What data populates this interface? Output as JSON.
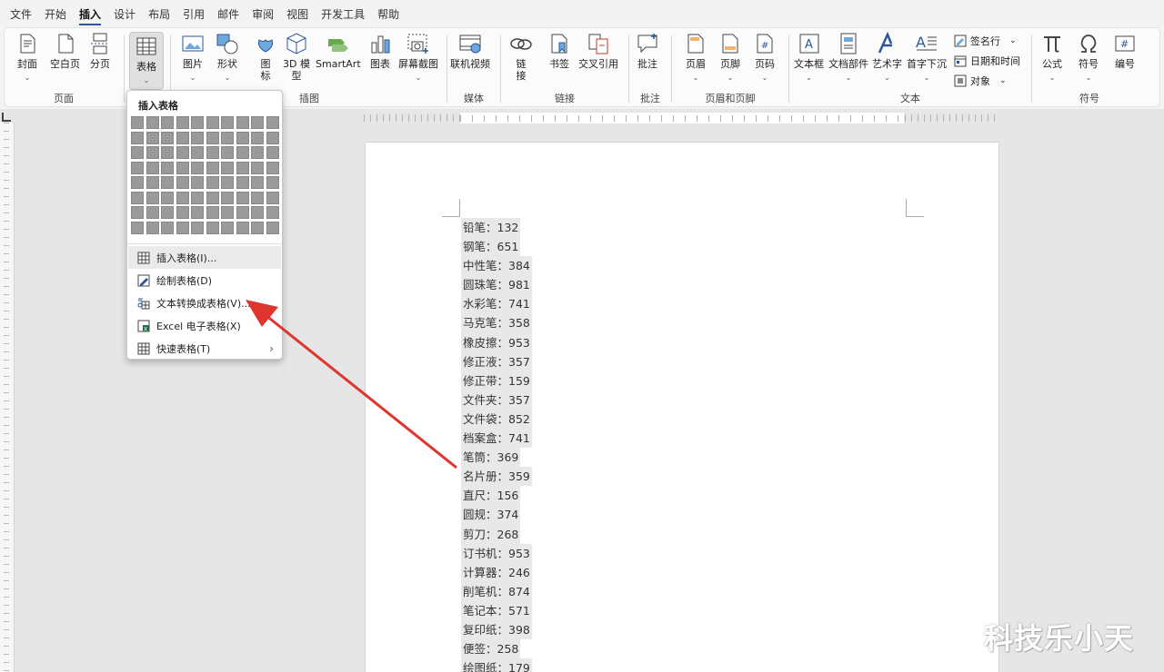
{
  "tabs": [
    "文件",
    "开始",
    "插入",
    "设计",
    "布局",
    "引用",
    "邮件",
    "审阅",
    "视图",
    "开发工具",
    "帮助"
  ],
  "active_tab": "插入",
  "ribbon": {
    "groups": {
      "page": "页面",
      "table": "表格",
      "illustrations": "插图",
      "media": "媒体",
      "links": "链接",
      "comments": "批注",
      "header_footer": "页眉和页脚",
      "text": "文本",
      "symbols": "符号"
    },
    "buttons": {
      "cover": "封面",
      "blank": "空白页",
      "pagebreak": "分页",
      "table": "表格",
      "picture": "图片",
      "shapes": "形状",
      "icons_1": "图",
      "icons_2": "标",
      "model_1": "3D 模",
      "model_2": "型",
      "smartart": "SmartArt",
      "chart": "图表",
      "screenshot": "屏幕截图",
      "video": "联机视频",
      "link_1": "链",
      "link_2": "接",
      "bookmark": "书签",
      "crossref": "交叉引用",
      "comment": "批注",
      "header": "页眉",
      "footer": "页脚",
      "pagenum": "页码",
      "textbox": "文本框",
      "quickparts": "文档部件",
      "wordart": "艺术字",
      "dropcap": "首字下沉",
      "signature": "签名行",
      "datetime": "日期和时间",
      "object": "对象",
      "equation": "公式",
      "symbol": "符号",
      "number": "编号"
    }
  },
  "dropdown": {
    "title": "插入表格",
    "items": [
      {
        "label": "插入表格(I)..."
      },
      {
        "label": "绘制表格(D)"
      },
      {
        "label": "文本转换成表格(V)..."
      },
      {
        "label": "Excel 电子表格(X)"
      },
      {
        "label": "快速表格(T)"
      }
    ]
  },
  "document_lines": [
    "铅笔：132",
    "钢笔：651",
    "中性笔：384",
    "圆珠笔：981",
    "水彩笔：741",
    "马克笔：358",
    "橡皮擦：953",
    "修正液：357",
    "修正带：159",
    "文件夹：357",
    "文件袋：852",
    "档案盒：741",
    "笔筒：369",
    "名片册：359",
    "直尺：156",
    "圆规：374",
    "剪刀：268",
    "订书机：953",
    "计算器：246",
    "削笔机：874",
    "笔记本：571",
    "复印纸：398",
    "便签：258",
    "绘图纸：179"
  ],
  "watermark": "科技乐小天",
  "colors": {
    "arrow": "#e0342f",
    "accent": "#2b5797"
  }
}
